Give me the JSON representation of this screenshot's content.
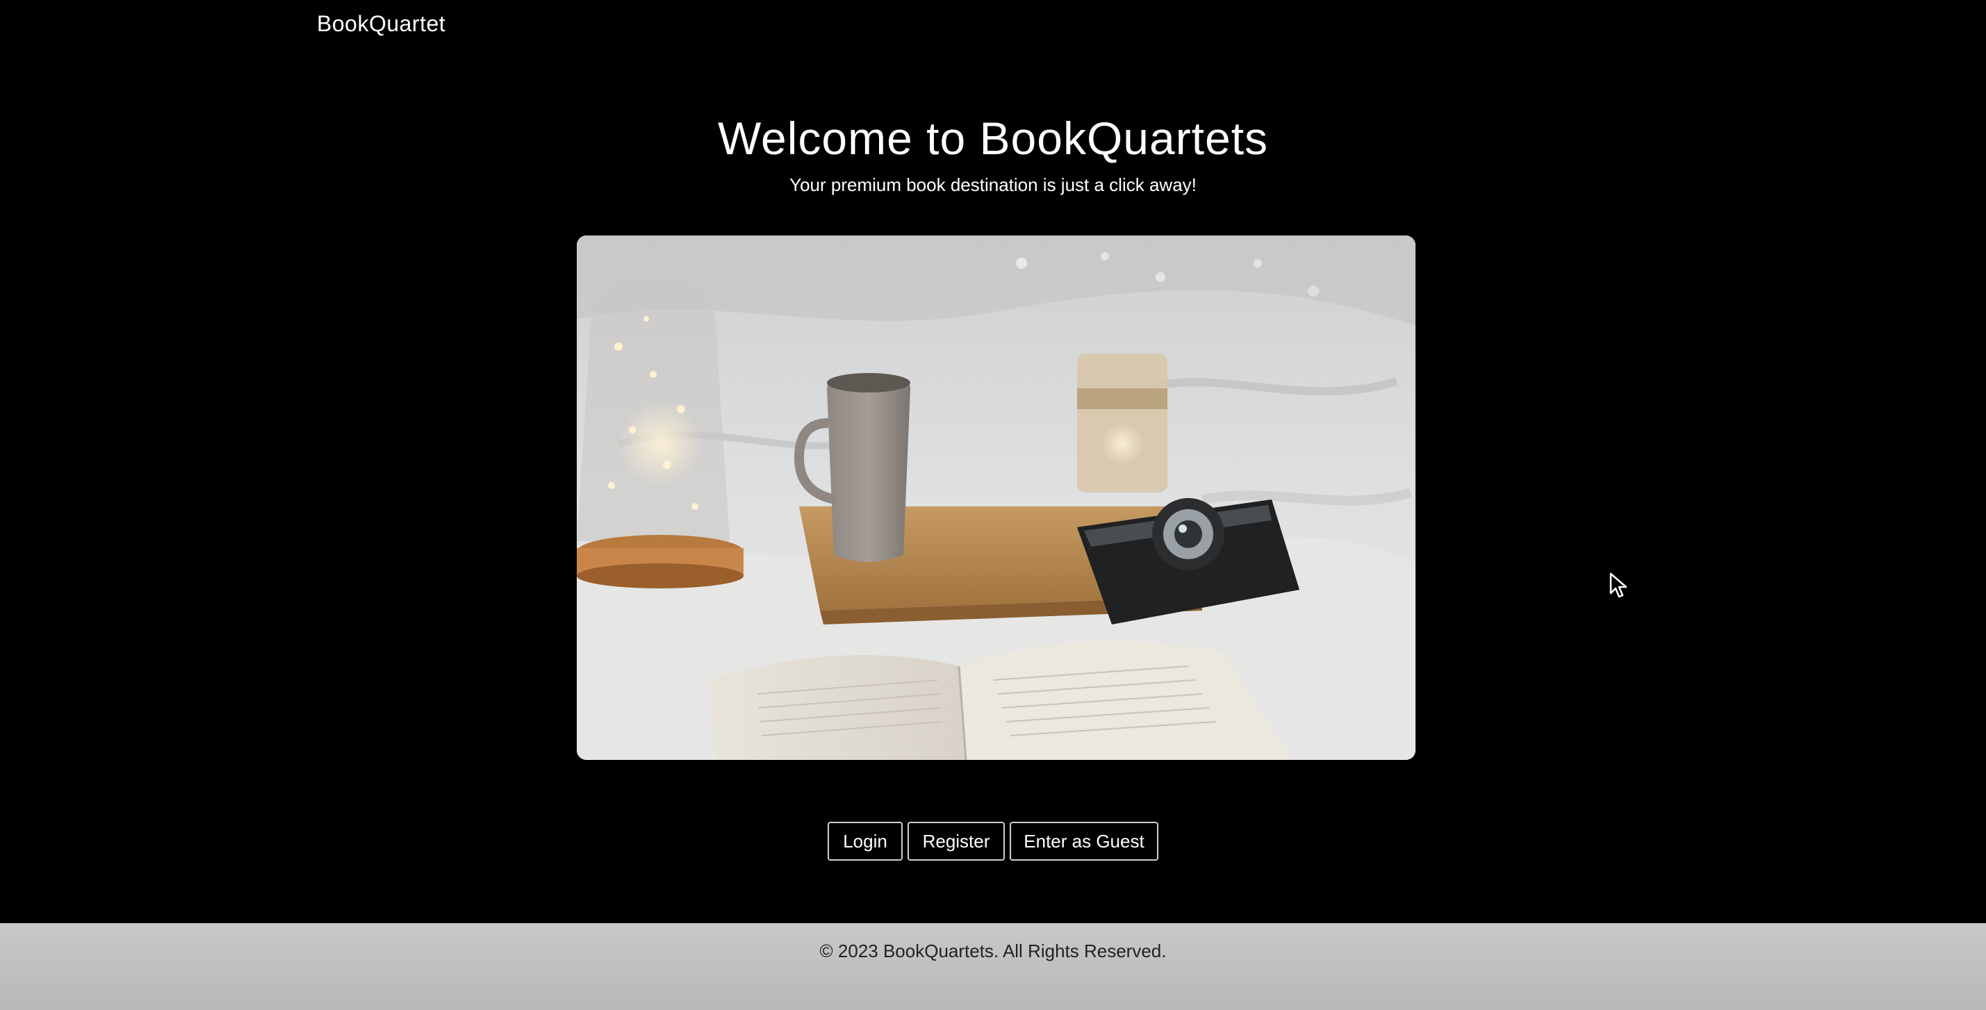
{
  "navbar": {
    "brand": "BookQuartet"
  },
  "hero": {
    "title": "Welcome to BookQuartets",
    "subtitle": "Your premium book destination is just a click away!",
    "image_icon": "hero-photo-book-coffee-camera"
  },
  "actions": {
    "login_label": "Login",
    "register_label": "Register",
    "guest_label": "Enter as Guest"
  },
  "footer": {
    "copyright": "© 2023 BookQuartets. All Rights Reserved."
  },
  "colors": {
    "background": "#000000",
    "text": "#ffffff",
    "button_border": "#cfcfcf",
    "footer_bg": "#c0c0c0",
    "footer_text": "#222222"
  },
  "cursor": {
    "icon": "mouse-pointer-icon"
  }
}
